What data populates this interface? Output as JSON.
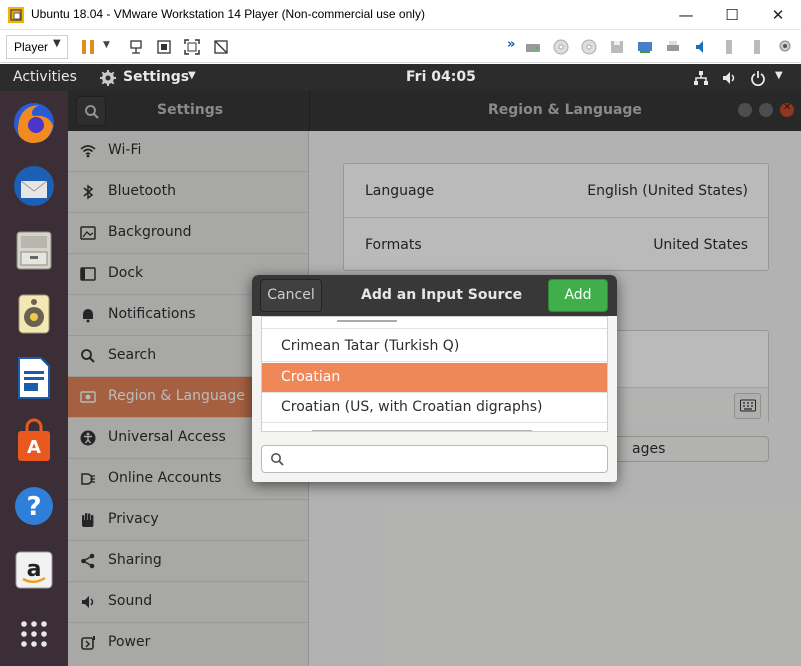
{
  "vmware": {
    "title": "Ubuntu 18.04 - VMware Workstation 14 Player (Non-commercial use only)",
    "player_menu": "Player"
  },
  "topbar": {
    "activities": "Activities",
    "app_menu": "Settings",
    "clock": "Fri 04:05"
  },
  "settings": {
    "sidebar_title": "Settings",
    "panel_title": "Region & Language",
    "sidebar_items": [
      {
        "label": "Wi-Fi",
        "icon": "wifi-icon"
      },
      {
        "label": "Bluetooth",
        "icon": "bluetooth-icon"
      },
      {
        "label": "Background",
        "icon": "background-icon"
      },
      {
        "label": "Dock",
        "icon": "dock-icon"
      },
      {
        "label": "Notifications",
        "icon": "bell-icon"
      },
      {
        "label": "Search",
        "icon": "search-icon"
      },
      {
        "label": "Region & Language",
        "icon": "region-icon"
      },
      {
        "label": "Universal Access",
        "icon": "accessibility-icon"
      },
      {
        "label": "Online Accounts",
        "icon": "online-accounts-icon"
      },
      {
        "label": "Privacy",
        "icon": "hand-icon"
      },
      {
        "label": "Sharing",
        "icon": "share-icon"
      },
      {
        "label": "Sound",
        "icon": "speaker-icon"
      },
      {
        "label": "Power",
        "icon": "power-icon"
      }
    ],
    "language_label": "Language",
    "language_value": "English (United States)",
    "formats_label": "Formats",
    "formats_value": "United States",
    "manage_fragment": "ages"
  },
  "dialog": {
    "title": "Add an Input Source",
    "cancel": "Cancel",
    "add": "Add",
    "items": [
      "Crimean Tatar (Turkish Q)",
      "Croatian",
      "Croatian (US, with Croatian digraphs)"
    ],
    "selected_index": 1,
    "search_placeholder": ""
  },
  "colors": {
    "accent": "#e2845a",
    "add_button": "#3fae4b",
    "dock_bg": "#3b2e36"
  }
}
